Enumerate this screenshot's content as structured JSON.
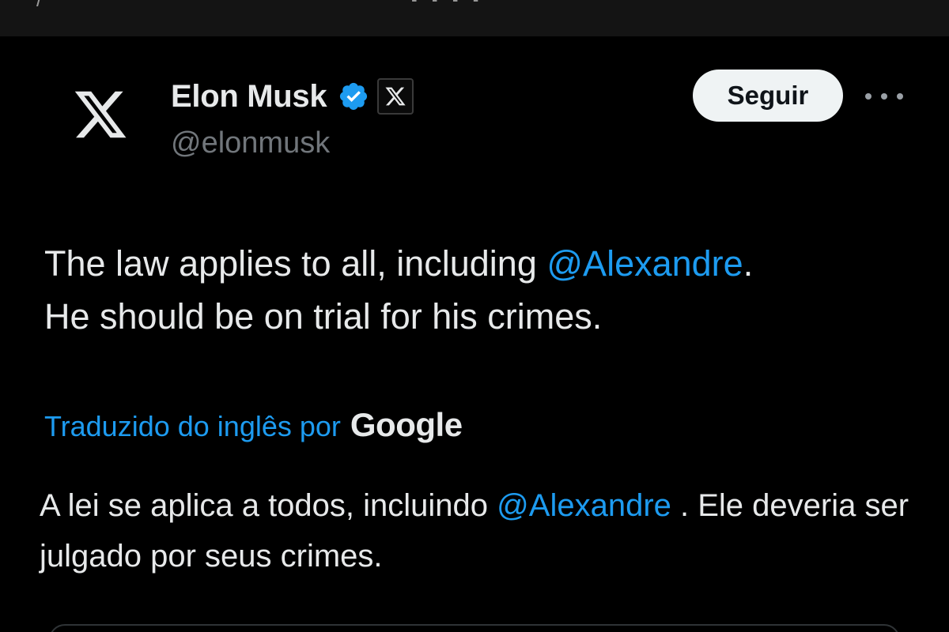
{
  "status_bar": {
    "left_glyph": "/",
    "center_glyph": "▪ ▪ ▪ ▪"
  },
  "author": {
    "display_name": "Elon Musk",
    "handle": "@elonmusk",
    "avatar_icon": "x-logo-icon",
    "verified_icon": "verified-badge-icon",
    "affiliate_icon": "x-logo-icon"
  },
  "actions": {
    "follow_label": "Seguir",
    "more_icon": "more-options-icon"
  },
  "tweet": {
    "line1_before": "The law applies to all, including ",
    "line1_mention": "@Alexandre",
    "line1_after": ".",
    "line2": "He should be on trial for his crimes."
  },
  "translation": {
    "translated_by": "Traduzido do inglês por",
    "provider": "Google",
    "text_before": "A lei se aplica a todos, incluindo ",
    "mention": "@Alexandre",
    "text_after": " . Ele deveria ser julgado por seus crimes."
  },
  "colors": {
    "background": "#000000",
    "text": "#e7e9ea",
    "secondary_text": "#71767b",
    "accent": "#1d9bf0",
    "follow_button_bg": "#eff3f4"
  }
}
